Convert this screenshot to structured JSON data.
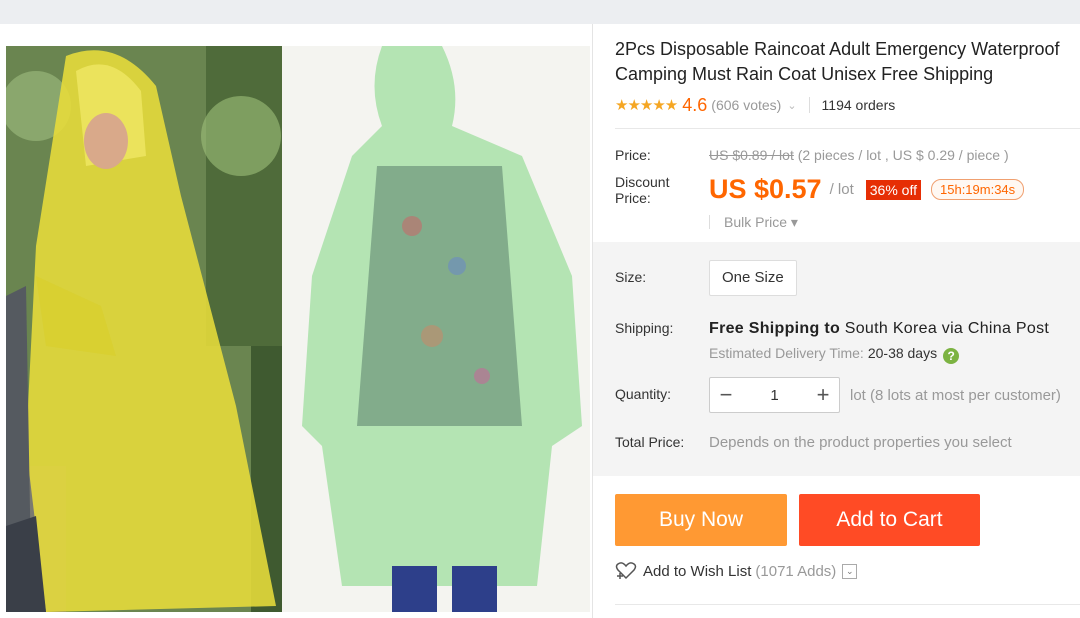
{
  "product": {
    "title_line1": "2Pcs Disposable Raincoat Adult Emergency Waterproof",
    "title_line2": "Camping Must Rain Coat Unisex Free Shipping",
    "stars": "★★★★★",
    "rating": "4.6",
    "votes": "(606 votes)",
    "votes_chevron": "⌄",
    "orders": "1194 orders"
  },
  "price": {
    "label": "Price:",
    "original": "US $0.89 / lot",
    "original_detail": " (2 pieces / lot , US $ 0.29 / piece )",
    "discount_label_line1": "Discount",
    "discount_label_line2": "Price:",
    "amount": "US $0.57",
    "unit": "/ lot",
    "discount_badge": "36% off",
    "timer": "15h:19m:34s",
    "bulk_price": "Bulk Price ▾"
  },
  "options": {
    "size_label": "Size:",
    "size_value": "One Size",
    "shipping_label": "Shipping:",
    "shipping_free": "Free Shipping to ",
    "shipping_dest": "South Korea via China Post",
    "estimated_label": "Estimated Delivery Time:",
    "estimated_days": "20-38 days",
    "help_glyph": "?",
    "quantity_label": "Quantity:",
    "quantity_minus": "−",
    "quantity_value": "1",
    "quantity_plus": "+",
    "quantity_note": "lot (8 lots at most per customer)",
    "total_label": "Total Price:",
    "total_note": "Depends on the product properties you select"
  },
  "actions": {
    "buy_now": "Buy Now",
    "add_to_cart": "Add to Cart",
    "wishlist_icon": "♡",
    "wishlist_label": "Add to Wish List",
    "wishlist_count": "(1071 Adds)",
    "wishlist_dropdown": "⌄"
  },
  "colors": {
    "price_orange": "#ff6600",
    "buy_now_bg": "#ff9933",
    "add_to_cart_bg": "#ff4b25",
    "badge_red": "#e62e04",
    "star_gold": "#f5a623"
  },
  "icons": [
    "star-icon",
    "chevron-down-icon",
    "help-icon",
    "minus-icon",
    "plus-icon",
    "heart-icon",
    "dropdown-icon"
  ]
}
